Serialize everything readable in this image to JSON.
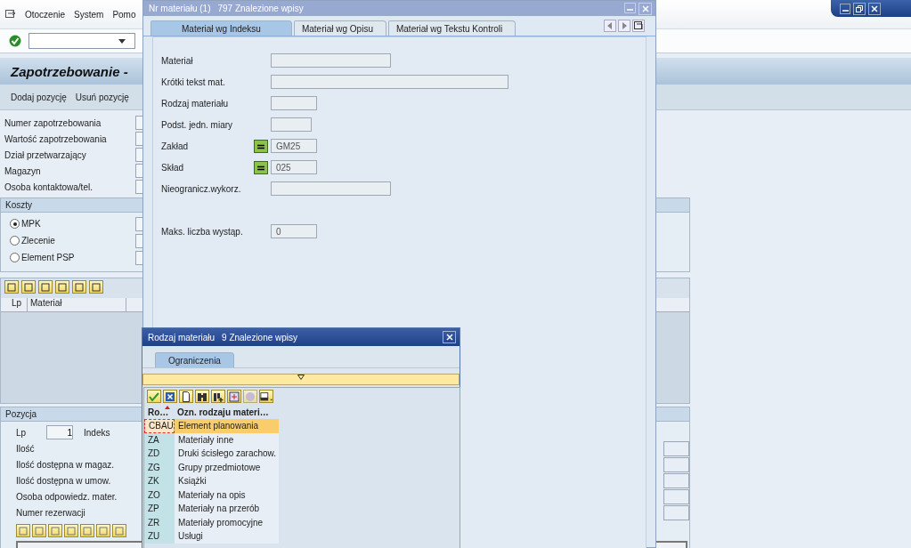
{
  "main_window": {
    "menu": [
      "Otoczenie",
      "System",
      "Pomo"
    ],
    "title": "Zapotrzebowanie -",
    "toolbar": [
      "Dodaj pozycję",
      "Usuń pozycję"
    ],
    "header_fields": [
      {
        "label": "Numer zapotrzebowania"
      },
      {
        "label": "Wartość zapotrzebowania"
      },
      {
        "label": "Dział przetwarzający"
      },
      {
        "label": "Magazyn"
      },
      {
        "label": "Osoba kontaktowa/tel."
      }
    ],
    "costs": {
      "title": "Koszty",
      "options": [
        {
          "label": "MPK",
          "selected": true
        },
        {
          "label": "Zlecenie",
          "selected": false
        },
        {
          "label": "Element PSP",
          "selected": false
        }
      ]
    },
    "items_table": {
      "columns": [
        "Lp",
        "Materiał"
      ]
    },
    "position": {
      "title": "Pozycja",
      "lp_label": "Lp",
      "lp_value": "1",
      "index_label": "Indeks",
      "fields": [
        "Ilość",
        "Ilość dostępna w magaz.",
        "Ilość dostępna w umow.",
        "Osoba odpowiedz. mater.",
        "Numer rezerwacji"
      ]
    }
  },
  "material_dialog": {
    "title": "Nr materiału (1)",
    "count": "797 Znalezione wpisy",
    "tabs": [
      {
        "label": "Materiał wg Indeksu",
        "selected": true
      },
      {
        "label": "Materiał wg Opisu",
        "selected": false
      },
      {
        "label": "Materiał wg Tekstu Kontroli",
        "selected": false
      }
    ],
    "fields": [
      {
        "label": "Materiał",
        "multiple": false
      },
      {
        "label": "Krótki tekst mat.",
        "multiple": false
      },
      {
        "label": "Rodzaj materiału",
        "multiple": false
      },
      {
        "label": "Podst. jedn. miary",
        "multiple": false
      },
      {
        "label": "Zakład",
        "value": "GM25",
        "multiple": true
      },
      {
        "label": "Skład",
        "value": "025",
        "multiple": true
      },
      {
        "label": "Nieogranicz.wykorz.",
        "multiple": false
      },
      {
        "label": "Maks. liczba wystąp.",
        "value": "0",
        "multiple": false
      }
    ]
  },
  "type_dialog": {
    "title": "Rodzaj materiału",
    "count": "9 Znalezione wpisy",
    "tabs": [
      {
        "label": "Ograniczenia",
        "selected": true
      }
    ],
    "columns": [
      "Ro…",
      "Ozn.  rodzaju materi…"
    ],
    "rows": [
      {
        "code": "CBAU",
        "text": "Element planowania",
        "selected": true
      },
      {
        "code": "ZA",
        "text": "Materiały inne",
        "selected": false
      },
      {
        "code": "ZD",
        "text": "Druki ścisłego zarachow.",
        "selected": false
      },
      {
        "code": "ZG",
        "text": "Grupy przedmiotowe",
        "selected": false
      },
      {
        "code": "ZK",
        "text": "Książki",
        "selected": false
      },
      {
        "code": "ZO",
        "text": "Materiały na opis",
        "selected": false
      },
      {
        "code": "ZP",
        "text": "Materiały na przerób",
        "selected": false
      },
      {
        "code": "ZR",
        "text": "Materiały promocyjne",
        "selected": false
      },
      {
        "code": "ZU",
        "text": "Usługi",
        "selected": false
      }
    ]
  }
}
